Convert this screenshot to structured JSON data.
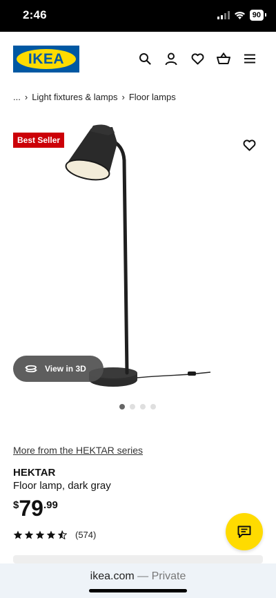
{
  "status_bar": {
    "time": "2:46",
    "battery": "90"
  },
  "header": {
    "logo_text": "IKEA",
    "icons": [
      "search-icon",
      "account-icon",
      "heart-icon",
      "basket-icon",
      "menu-icon"
    ]
  },
  "breadcrumb": {
    "ellipsis": "...",
    "items": [
      "Light fixtures & lamps",
      "Floor lamps"
    ]
  },
  "product": {
    "badge": "Best Seller",
    "view3d_label": "View in 3D",
    "carousel": {
      "count": 4,
      "active_index": 0
    },
    "series_link": "More from the HEKTAR series",
    "name": "HEKTAR",
    "description": "Floor lamp, dark gray",
    "price": {
      "currency": "$",
      "integer": "79",
      "decimal": ".99"
    },
    "rating": {
      "stars": 4.5,
      "max": 5,
      "count_text": "(574)"
    }
  },
  "browser": {
    "domain": "ikea.com",
    "mode": " — Private"
  },
  "colors": {
    "ikea_blue": "#0058a3",
    "ikea_yellow": "#ffdb00",
    "badge_red": "#cc0008"
  }
}
